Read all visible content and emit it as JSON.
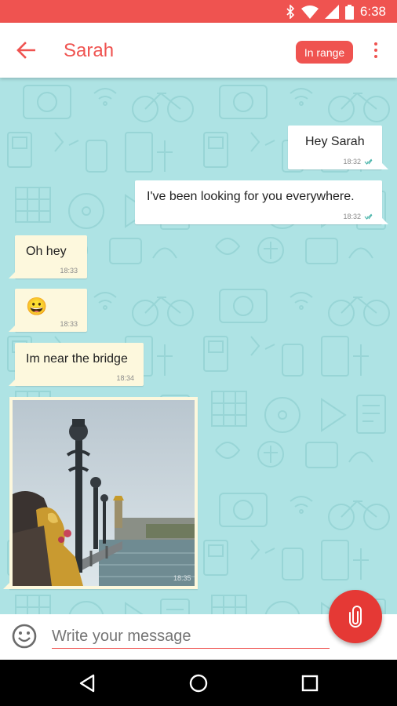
{
  "status_bar": {
    "time": "6:38"
  },
  "header": {
    "contact_name": "Sarah",
    "range_badge": "In range"
  },
  "messages": [
    {
      "direction": "out",
      "text": "Hey Sarah",
      "time": "18:32",
      "read": true
    },
    {
      "direction": "out",
      "text": "I've been looking for you everywhere.",
      "time": "18:32",
      "read": true
    },
    {
      "direction": "in",
      "text": "Oh hey",
      "time": "18:33"
    },
    {
      "direction": "in",
      "text": "😀",
      "time": "18:33"
    },
    {
      "direction": "in",
      "text": "Im near the bridge",
      "time": "18:34"
    },
    {
      "direction": "in",
      "type": "image",
      "time": "18:35"
    }
  ],
  "composer": {
    "placeholder": "Write your message"
  },
  "colors": {
    "accent": "#ef5350",
    "chat_bg": "#aee3e4",
    "incoming_bubble": "#fdf8dd",
    "outgoing_bubble": "#ffffff",
    "check": "#4db6ac"
  },
  "icons": {
    "back": "arrow-left-icon",
    "overflow": "more-vert-icon",
    "emoji": "emoji-icon",
    "attach": "paperclip-icon",
    "nav": [
      "back-triangle-icon",
      "home-circle-icon",
      "recents-square-icon"
    ]
  }
}
